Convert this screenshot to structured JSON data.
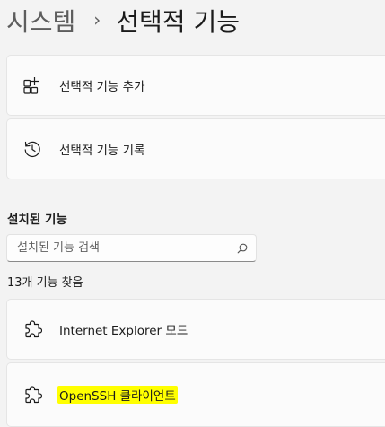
{
  "breadcrumb": {
    "parent": "시스템",
    "separator": "›",
    "current": "선택적 기능"
  },
  "actions": [
    {
      "label": "선택적 기능 추가",
      "icon": "add-grid-icon"
    },
    {
      "label": "선택적 기능 기록",
      "icon": "history-icon"
    }
  ],
  "installed": {
    "title": "설치된 기능",
    "search_placeholder": "설치된 기능 검색",
    "search_value": "",
    "count_text": "13개 기능 찾음",
    "items": [
      {
        "label": "Internet Explorer 모드",
        "icon": "puzzle-icon",
        "highlighted": false
      },
      {
        "label": "OpenSSH 클라이언트",
        "icon": "puzzle-icon",
        "highlighted": true,
        "highlight_color": "#ffff00"
      }
    ]
  }
}
